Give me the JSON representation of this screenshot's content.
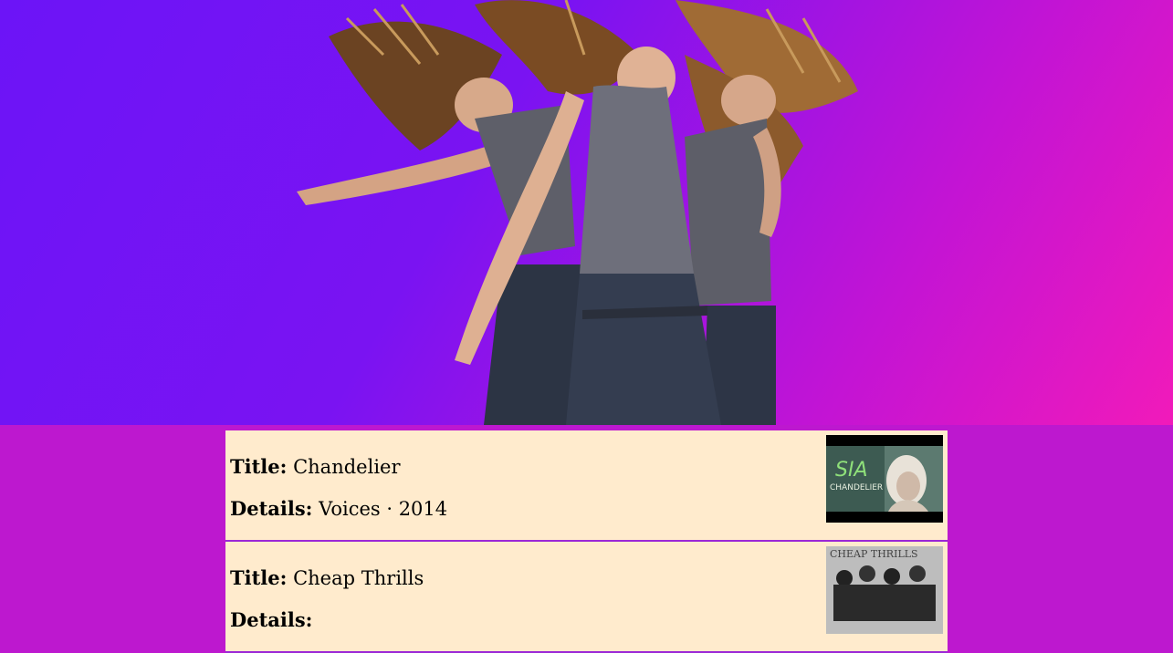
{
  "hero": {
    "image": "dancing-women-illustration"
  },
  "labels": {
    "title": "Title:",
    "details": "Details:"
  },
  "songs": [
    {
      "title": "Chandelier",
      "details": "Voices · 2014",
      "thumbnail": {
        "icon": "chandelier-thumbnail",
        "logo_text": "SIA",
        "caption": "CHANDELIER"
      }
    },
    {
      "title": "Cheap Thrills",
      "details": "",
      "thumbnail": {
        "icon": "cheap-thrills-thumbnail",
        "logo_text": "CHEAP THRILLS"
      }
    }
  ],
  "colors": {
    "hero_gradient_start": "#6c14f7",
    "hero_gradient_end": "#f11aba",
    "page_background": "#bd18cf",
    "card_background": "#ffebcd",
    "card_divider": "#9b28d6"
  }
}
